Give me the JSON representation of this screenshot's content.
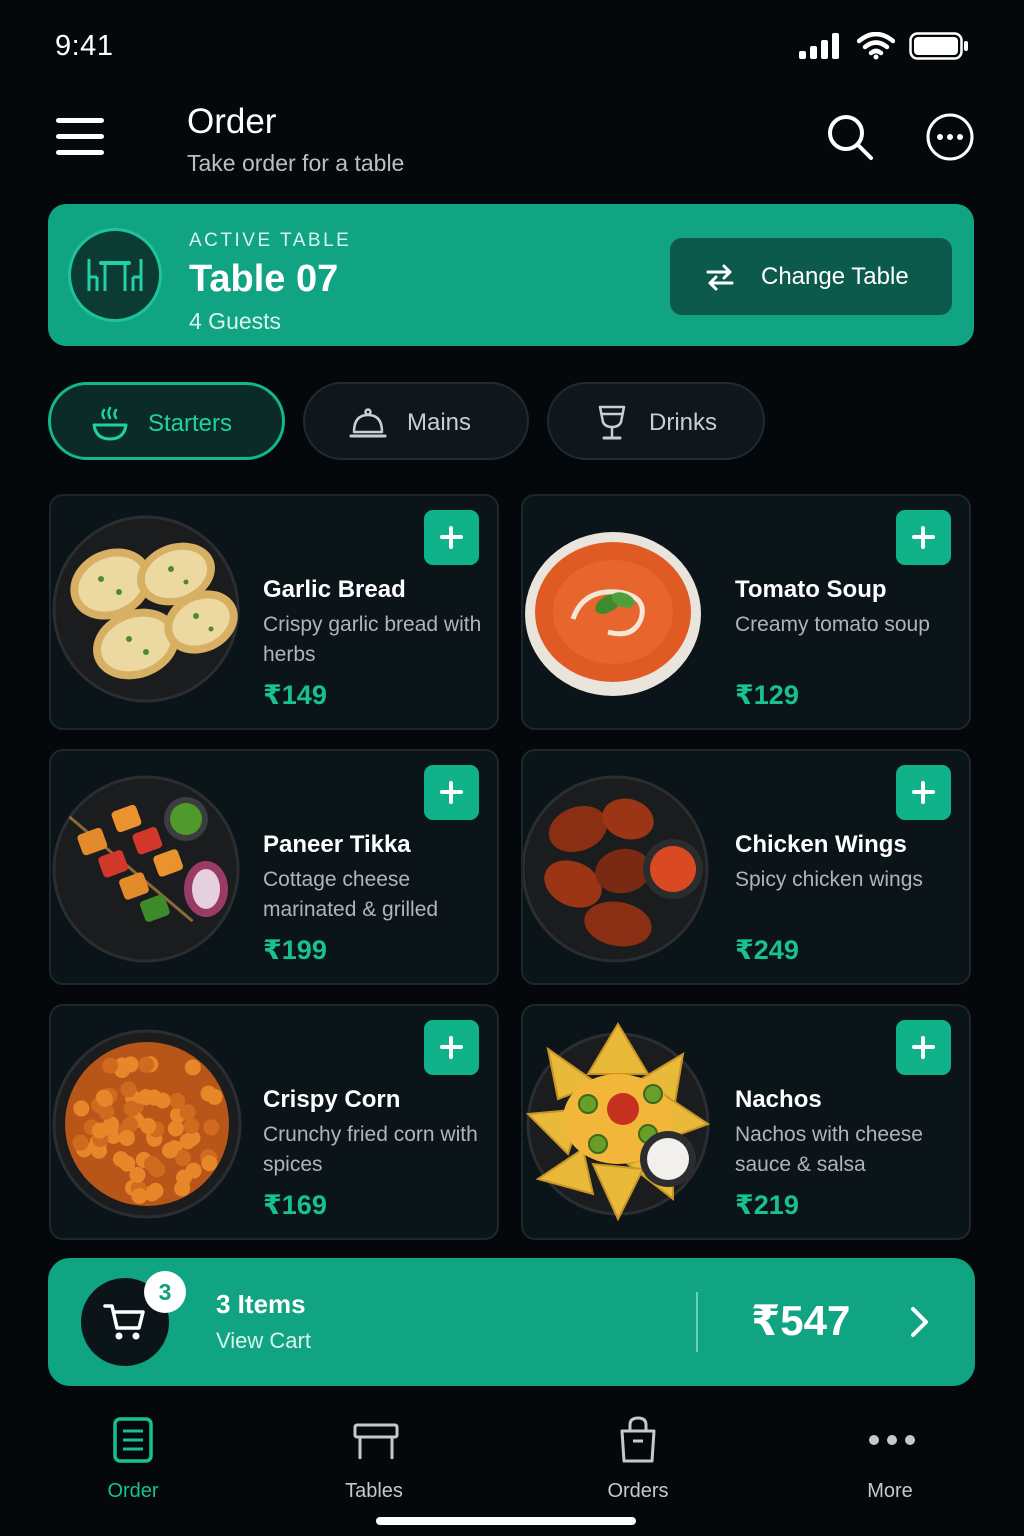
{
  "status_bar": {
    "time": "9:41"
  },
  "header": {
    "title": "Order",
    "subtitle": "Take order for a table"
  },
  "active_table": {
    "eyebrow": "ACTIVE TABLE",
    "name": "Table 07",
    "guests": "4 Guests",
    "change_label": "Change Table"
  },
  "categories": [
    {
      "label": "Starters",
      "icon": "bowl-icon",
      "active": true
    },
    {
      "label": "Mains",
      "icon": "cloche-icon",
      "active": false
    },
    {
      "label": "Drinks",
      "icon": "glass-icon",
      "active": false
    }
  ],
  "items": [
    {
      "name": "Garlic Bread",
      "desc": "Crispy garlic bread with herbs",
      "price": "₹149"
    },
    {
      "name": "Tomato Soup",
      "desc": "Creamy tomato soup",
      "price": "₹129"
    },
    {
      "name": "Paneer Tikka",
      "desc": "Cottage cheese marinated & grilled",
      "price": "₹199"
    },
    {
      "name": "Chicken Wings",
      "desc": "Spicy chicken wings",
      "price": "₹249"
    },
    {
      "name": "Crispy Corn",
      "desc": "Crunchy fried corn with spices",
      "price": "₹169"
    },
    {
      "name": "Nachos",
      "desc": "Nachos with cheese sauce & salsa",
      "price": "₹219"
    }
  ],
  "cart": {
    "count": "3",
    "items_label": "3 Items",
    "view_label": "View Cart",
    "total": "₹547"
  },
  "nav": [
    {
      "label": "Order",
      "icon": "order-icon",
      "active": true
    },
    {
      "label": "Tables",
      "icon": "table-icon",
      "active": false
    },
    {
      "label": "Orders",
      "icon": "bag-icon",
      "active": false
    },
    {
      "label": "More",
      "icon": "dots-icon",
      "active": false
    }
  ],
  "colors": {
    "accent": "#10a483",
    "price": "#17c192",
    "background": "#05080b"
  }
}
